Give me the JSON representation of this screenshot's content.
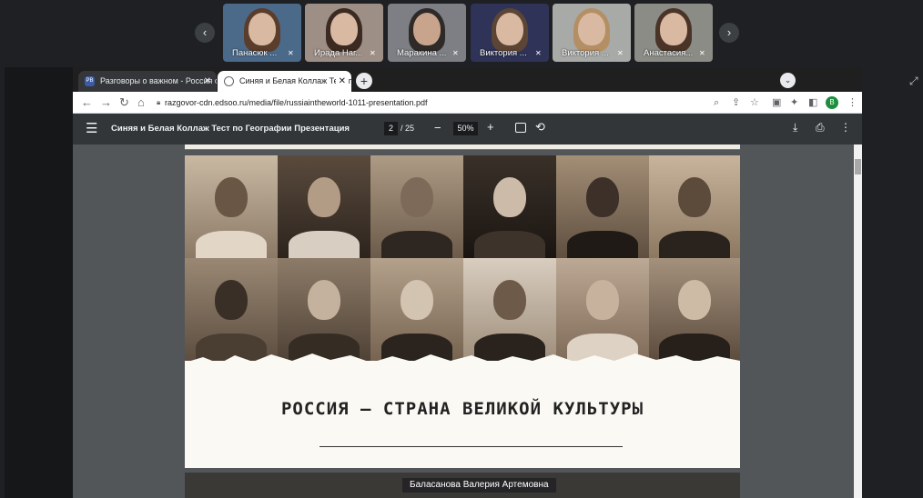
{
  "participants": [
    {
      "name": "Панасюк ...",
      "muted": true
    },
    {
      "name": "Ирада Наг...",
      "muted": true
    },
    {
      "name": "Маракина ...",
      "muted": true
    },
    {
      "name": "Виктория ...",
      "muted": true
    },
    {
      "name": "Виктория ...",
      "muted": true
    },
    {
      "name": "Анастасия...",
      "muted": true
    }
  ],
  "strip": {
    "prev_icon": "‹",
    "next_icon": "›"
  },
  "browser": {
    "tabs": [
      {
        "label": "Разговоры о важном - Россия с",
        "favicon": "РВ",
        "active": false
      },
      {
        "label": "Синяя и Белая Коллаж Тест по Г",
        "favicon": "",
        "active": true
      }
    ],
    "url": "razgovor-cdn.edsoo.ru/media/file/russiaintheworld-1011-presentation.pdf",
    "profile_initial": "B"
  },
  "pdf": {
    "title": "Синяя и Белая Коллаж Тест по Географии Презентация",
    "page_current": "2",
    "page_total": "/ 25",
    "zoom": "50%"
  },
  "slide": {
    "title": "РОССИЯ – СТРАНА ВЕЛИКОЙ КУЛЬТУРЫ"
  },
  "speaker_name": "Баласанова Валерия Артемовна",
  "colors": {
    "accent": "#1a73e8",
    "pdf_toolbar": "#323639",
    "viewer_bg": "#525659"
  }
}
